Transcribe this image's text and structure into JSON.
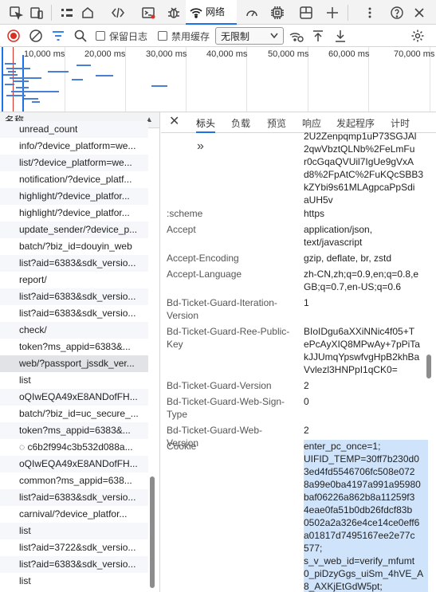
{
  "tabbar": {
    "network_label": "网络",
    "icons": [
      "inspect-icon",
      "device-toggle-icon",
      "home-icon",
      "elements-icon",
      "console-icon",
      "bug-icon",
      "network-icon",
      "performance-icon",
      "settings-cog-icon",
      "application-icon",
      "add-icon",
      "more-icon",
      "help-icon",
      "close-icon"
    ]
  },
  "toolbar": {
    "preserve_log": "保留日志",
    "disable_cache": "禁用缓存",
    "throttle_value": "无限制"
  },
  "overview": {
    "ticks": [
      "10,000 ms",
      "20,000 ms",
      "30,000 ms",
      "40,000 ms",
      "50,000 ms",
      "60,000 ms",
      "70,000 ms"
    ]
  },
  "list": {
    "header": "名称",
    "rows": [
      "unread_count",
      "info/?device_platform=we...",
      "list/?device_platform=we...",
      "notification/?device_platf...",
      "highlight/?device_platfor...",
      "highlight/?device_platfor...",
      "update_sender/?device_p...",
      "batch/?biz_id=douyin_web",
      "list?aid=6383&sdk_versio...",
      "report/",
      "list?aid=6383&sdk_versio...",
      "list?aid=6383&sdk_versio...",
      "check/",
      "token?ms_appid=6383&...",
      "web/?passport_jssdk_ver...",
      "list",
      "oQIwEQA49xE8ANDofFH...",
      "batch/?biz_id=uc_secure_...",
      "token?ms_appid=6383&...",
      "◌ c6b2f994c3b532d088a...",
      "oQIwEQA49xE8ANDofFH...",
      "common?ms_appid=638...",
      "list?aid=6383&sdk_versio...",
      "carnival/?device_platfor...",
      "list",
      "list?aid=3722&sdk_versio...",
      "list?aid=6383&sdk_versio...",
      "list"
    ]
  },
  "details": {
    "tabs": [
      "标头",
      "负载",
      "预览",
      "响应",
      "发起程序",
      "计时"
    ],
    "top_value_lines": [
      "2U2Zenpqmp1uP73SGJAl",
      "2qwVbztQLNb%2FeLmFu",
      "r0cGqaQVUil7IgUe9gVxA",
      "d8%2FpAtC%2FuKQcSBB3",
      "kZYbi9s61MLAgpcaPpSdi",
      "aUH5v"
    ],
    "headers": [
      {
        "key": "scheme_label",
        "name": ":scheme",
        "value": [
          "https"
        ]
      },
      {
        "key": "accept",
        "name": "Accept",
        "value": [
          "application/json,",
          "text/javascript"
        ]
      },
      {
        "key": "accept_encoding",
        "name": "Accept-Encoding",
        "value": [
          "gzip, deflate, br, zstd"
        ]
      },
      {
        "key": "accept_language",
        "name": "Accept-Language",
        "value": [
          "zh-CN,zh;q=0.9,en;q=0.8,e",
          "GB;q=0.7,en-US;q=0.6"
        ]
      },
      {
        "key": "iteration",
        "name": "Bd-Ticket-Guard-Iteration-Version",
        "value": [
          "1"
        ]
      },
      {
        "key": "ree",
        "name": "Bd-Ticket-Guard-Ree-Public-Key",
        "value": [
          "BIoIDgu6aXXiNNic4f05+T",
          "ePcAyXIQ8MPwAy+7pPiTa",
          "kJJUmqYpswfvgHpB2khBa",
          "Vvlezl3HNPpI1qCK0="
        ]
      },
      {
        "key": "version",
        "name": "Bd-Ticket-Guard-Version",
        "value": [
          "2"
        ]
      },
      {
        "key": "web_sign",
        "name": "Bd-Ticket-Guard-Web-Sign-Type",
        "value": [
          "0"
        ]
      },
      {
        "key": "web_version",
        "name": "Bd-Ticket-Guard-Web-Version",
        "value": [
          "2"
        ]
      },
      {
        "key": "cookie",
        "name": "Cookie",
        "value": [
          "enter_pc_once=1;",
          "UIFID_TEMP=30ff7b230d0",
          "3ed4fd5546706fc508e072",
          "8a99e0ba4197a991a95980",
          "baf06226a862b8a11259f3",
          "4eae0fa51b0db26fdcf83b",
          "0502a2a326e4ce14ce0eff6",
          "a01817d7495167ee2e77c",
          "577;",
          "s_v_web_id=verify_mfumt",
          "0_piDzyGgs_uiSm_4hVE_A",
          "8_AXKjEtGdW5pt;"
        ]
      }
    ]
  },
  "colors": {
    "accent": "#1a73e8",
    "record_red": "#d93025",
    "highlight": "#cfe4fb"
  }
}
